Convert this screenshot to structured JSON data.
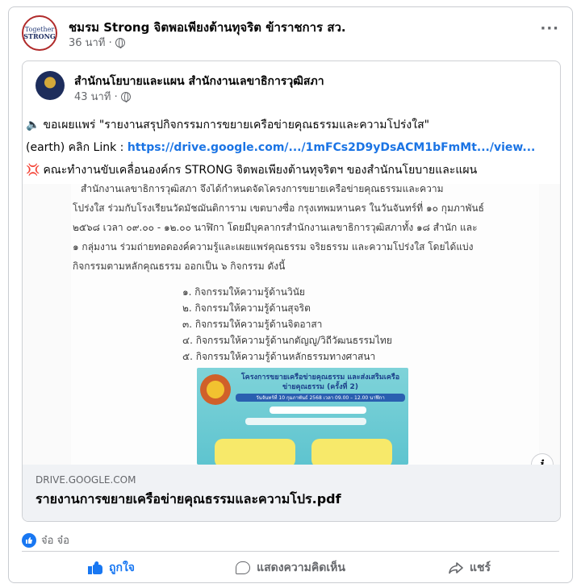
{
  "post": {
    "page_name": "ชมรม Strong จิตพอเพียงต้านทุจริต ข้าราชการ สว.",
    "time": "36 นาที ·",
    "avatar_line1": "Together",
    "avatar_line2": "STRONG",
    "more_label": "···"
  },
  "shared": {
    "page_name": "สำนักนโยบายและแผน สำนักงานเลขาธิการวุฒิสภา",
    "time": "43 นาที ·",
    "line1_emoji": "🔈",
    "line1": "ขอเผยแพร่ \"รายงานสรุปกิจกรรมการขยายเครือข่ายคุณธรรมและความโปร่งใส\"",
    "line2_prefix": "(earth) คลิก Link : ",
    "line2_link": "https://drive.google.com/.../1mFCs2D9yDsACM1bFmMt.../view...",
    "line3_icon": "💢",
    "line3": "คณะทำงานขับเคลื่อนองค์กร STRONG จิตพอเพียงต้านทุจริตฯ ของสำนักนโยบายและแผน",
    "doc": {
      "para": [
        "สำนักงานเลขาธิการวุฒิสภา จึงได้กำหนดจัดโครงการขยายเครือข่ายคุณธรรมและความ",
        "โปร่งใส ร่วมกับโรงเรียนวัดมัชฌันติการาม เขตบางซื่อ กรุงเทพมหานคร ในวันจันทร์ที่ ๑๐ กุมภาพันธ์",
        "๒๕๖๘ เวลา ๐๙.๐๐ - ๑๒.๐๐ นาฬิกา โดยมีบุคลากรสำนักงานเลขาธิการวุฒิสภาทั้ง ๑๘ สำนัก และ",
        "๑ กลุ่มงาน ร่วมถ่ายทอดองค์ความรู้และเผยแพร่คุณธรรม จริยธรรม และความโปร่งใส โดยได้แบ่ง",
        "กิจกรรมตามหลักคุณธรรม ออกเป็น ๖ กิจกรรม ดังนี้"
      ],
      "list": [
        "๑. กิจกรรมให้ความรู้ด้านวินัย",
        "๒. กิจกรรมให้ความรู้ด้านสุจริต",
        "๓. กิจกรรมให้ความรู้ด้านจิตอาสา",
        "๔. กิจกรรมให้ความรู้ด้านกตัญญู/วิถีวัฒนธรรมไทย",
        "๕. กิจกรรมให้ความรู้ด้านหลักธรรมทางศาสนา"
      ],
      "poster_title": "โครงการขยายเครือข่ายคุณธรรม และส่งเสริมเครือข่ายคุณธรรม (ครั้งที่ 2)",
      "poster_sub": "วันจันทร์ที่ 10 กุมภาพันธ์ 2568 เวลา 09.00 – 12.00 นาฬิกา"
    },
    "domain": "DRIVE.GOOGLE.COM",
    "file_title": "รายงานการขยายเครือข่ายคุณธรรมและความโปร.pdf",
    "info_label": "i"
  },
  "reactions": {
    "icon": "like-icon",
    "text": "จ๋อ จ๋อ"
  },
  "actions": {
    "like": "ถูกใจ",
    "comment": "แสดงความคิดเห็น",
    "share": "แชร์"
  },
  "colors": {
    "accent": "#1877f2",
    "link": "#1b74e4",
    "muted": "#65676b"
  }
}
